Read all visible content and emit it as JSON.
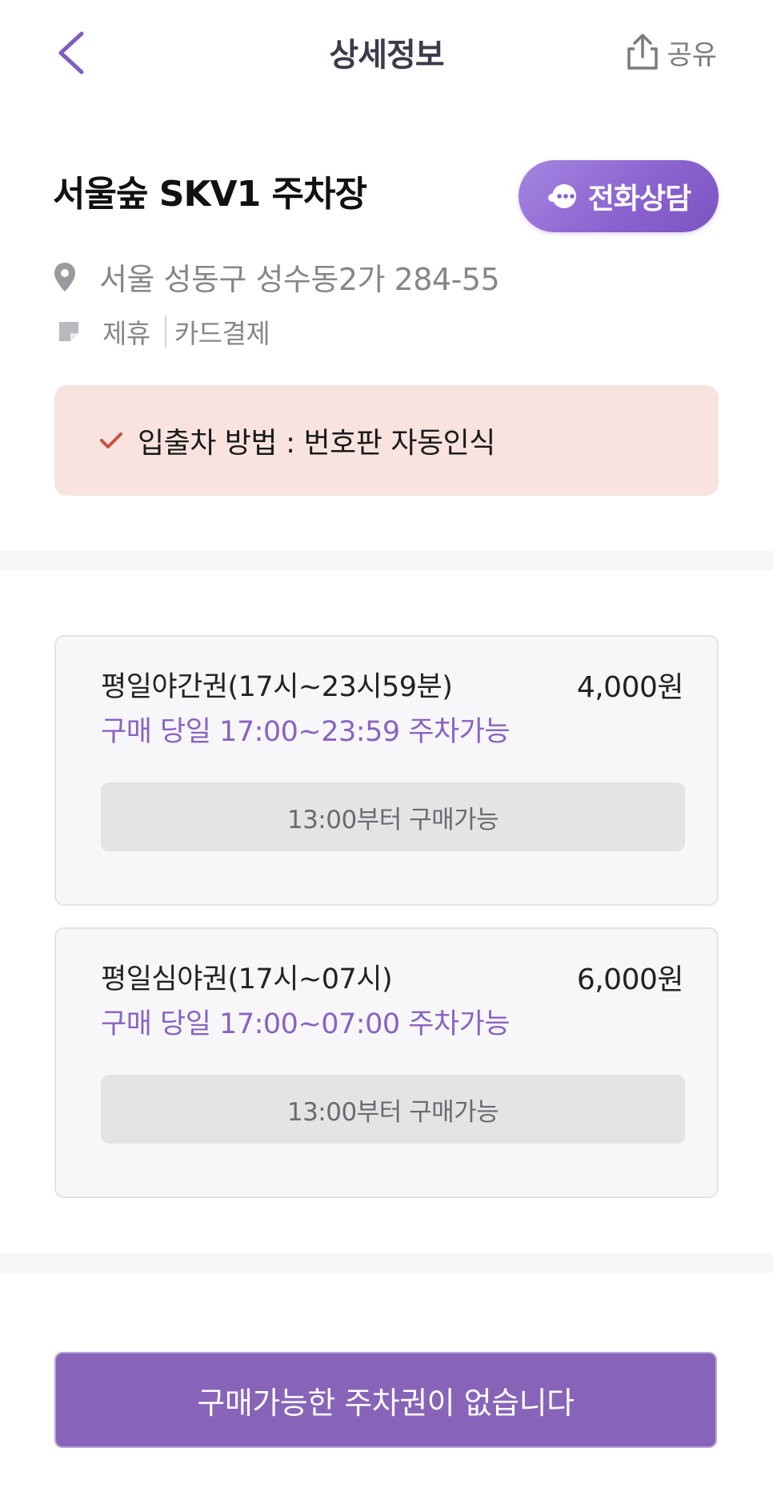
{
  "header": {
    "title": "상세정보",
    "share_label": "공유",
    "back_icon": "chevron-left-icon",
    "share_icon": "share-icon"
  },
  "lot": {
    "name": "서울숲 SKV1 주차장",
    "call_label": "전화상담",
    "address": "서울 성동구 성수동2가 284-55",
    "tags": [
      "제휴",
      "카드결제"
    ]
  },
  "notice": {
    "text": "입출차 방법 : 번호판 자동인식"
  },
  "tickets": [
    {
      "name": "평일야간권(17시~23시59분)",
      "price": "4,000원",
      "desc": "구매 당일 17:00~23:59 주차가능",
      "button": "13:00부터 구매가능"
    },
    {
      "name": "평일심야권(17시~07시)",
      "price": "6,000원",
      "desc": "구매 당일 17:00~07:00 주차가능",
      "button": "13:00부터 구매가능"
    }
  ],
  "footer": {
    "button_label": "구매가능한 주차권이 없습니다"
  },
  "colors": {
    "accent": "#8764b8",
    "accent_text": "#8a63c2",
    "notice_bg": "#f8e3df",
    "check": "#c9523f"
  }
}
